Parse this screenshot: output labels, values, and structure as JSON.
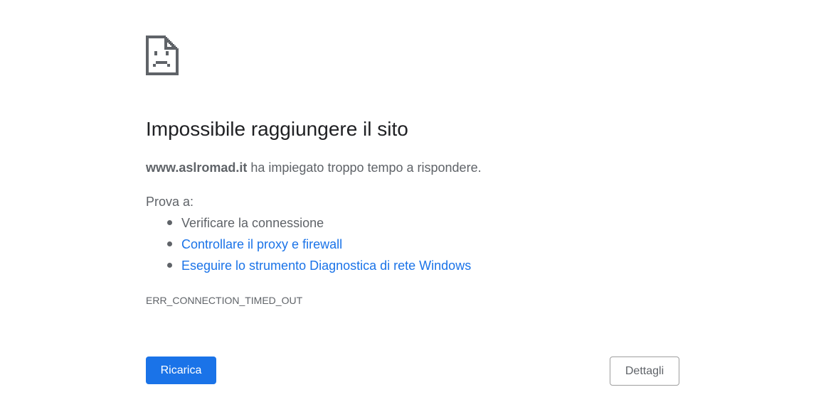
{
  "error": {
    "icon": "sad-document-icon",
    "title": "Impossibile raggiungere il sito",
    "summary": {
      "host": "www.aslromad.it",
      "message": " ha impiegato troppo tempo a rispondere."
    },
    "suggestions_intro": "Prova a:",
    "suggestions": [
      {
        "label": "Verificare la connessione",
        "is_link": false
      },
      {
        "label": "Controllare il proxy e firewall",
        "is_link": true
      },
      {
        "label": "Eseguire lo strumento Diagnostica di rete Windows",
        "is_link": true
      }
    ],
    "code": "ERR_CONNECTION_TIMED_OUT"
  },
  "buttons": {
    "reload_label": "Ricarica",
    "details_label": "Dettagli"
  },
  "colors": {
    "primary": "#1a73e8",
    "text": "#5f6368",
    "heading": "#202124",
    "icon": "#5f6368"
  }
}
